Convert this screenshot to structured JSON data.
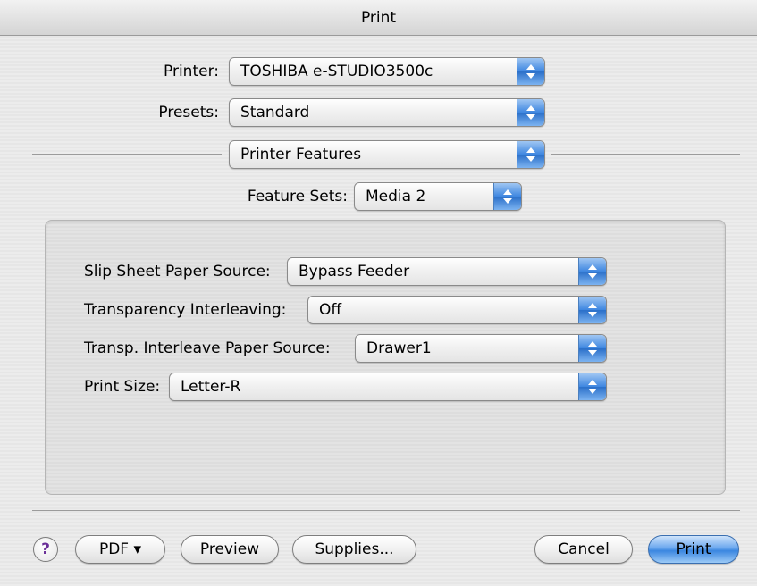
{
  "window": {
    "title": "Print"
  },
  "printer": {
    "label": "Printer:",
    "value": "TOSHIBA e-STUDIO3500c"
  },
  "presets": {
    "label": "Presets:",
    "value": "Standard"
  },
  "panel_selector": {
    "value": "Printer Features"
  },
  "feature_sets": {
    "label": "Feature Sets:",
    "value": "Media 2"
  },
  "options": {
    "slip_sheet": {
      "label": "Slip Sheet Paper Source:",
      "value": "Bypass Feeder"
    },
    "transparency": {
      "label": "Transparency Interleaving:",
      "value": "Off"
    },
    "transp_source": {
      "label": "Transp. Interleave Paper Source:",
      "value": "Drawer1"
    },
    "print_size": {
      "label": "Print Size:",
      "value": "Letter-R"
    }
  },
  "buttons": {
    "help": "?",
    "pdf": "PDF ▾",
    "preview": "Preview",
    "supplies": "Supplies...",
    "cancel": "Cancel",
    "print": "Print"
  },
  "icons": {
    "popup_arrows": "up-down-arrows-icon",
    "help": "help-icon"
  },
  "colors": {
    "accent_blue": "#3a86e0",
    "help_glyph": "#6a2f98"
  }
}
